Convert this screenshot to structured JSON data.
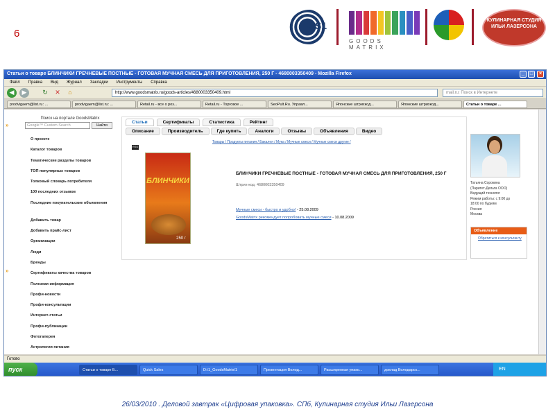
{
  "slide": {
    "number": "6",
    "footer": "26/03/2010 . Деловой завтрак «Цифровая упаковка». СПб, Кулинарная студия Ильи Лазерсона"
  },
  "logos": {
    "gs1": "GS1",
    "goods_matrix": "GOODS MATRIX",
    "studio": "КУЛИНАРНАЯ СТУДИЯ ИЛЬИ ЛАЗЕРСОНА",
    "gm_colors": [
      "#6a2b8a",
      "#b22c8a",
      "#d93a3a",
      "#f06a2a",
      "#f3c623",
      "#9fc43a",
      "#3aa35a",
      "#2a8fc0",
      "#4a5fc8",
      "#7a3ab8"
    ]
  },
  "browser": {
    "title": "Статьи о товаре БЛИНЧИКИ ГРЕЧНЕВЫЕ ПОСТНЫЕ - ГОТОВАЯ МУЧНАЯ СМЕСЬ ДЛЯ ПРИГОТОВЛЕНИЯ, 250 Г - 4680003350409 - Mozilla Firefox",
    "menu": [
      "Правка",
      "Вид",
      "Журнал",
      "Закладки",
      "Инструменты",
      "Справка"
    ],
    "menu_first": "Файл",
    "url": "http://www.goodsmatrix.ru/goods-articles/4680003350409.html",
    "search_placeholder": "mail.ru: Поиск в Интернете",
    "tabs": [
      "prodvigaem@list.ru: ...",
      "prodvigaem@list.ru: ...",
      "Retail.ru - все о роз...",
      "Retail.ru - Торговое ...",
      "SeoPult.Ru. Управл...",
      "Японские штрихкод...",
      "Японские штрихкод...",
      "Статьи о товаре ..."
    ],
    "status": "Готово"
  },
  "sidebar": {
    "search_title": "Поиск на портале GoodsMatrix",
    "search_placeholder": "Google™ Custom Search",
    "search_button": "Найти",
    "items": [
      "О проекте",
      "Каталог товаров",
      "Тематические разделы товаров",
      "ТОП популярных товаров",
      "Толковый словарь потребителя",
      "100 последних отзывов",
      "Последние покупательские объявления",
      "Добавить товар",
      "Добавить прайс-лист",
      "Организации",
      "Люди",
      "Бренды",
      "Сертификаты качества товаров",
      "Полезная информация",
      "Профи-новости",
      "Профи-консультации",
      "Интернет-статьи",
      "Профи-публикации",
      "Фотогалерея",
      "Астрология питания"
    ]
  },
  "main": {
    "tabs1": [
      "Статьи",
      "Сертификаты",
      "Статистика",
      "Рейтинг"
    ],
    "tabs2": [
      "Описание",
      "Производитель",
      "Где купить",
      "Аналоги",
      "Отзывы",
      "Объявления",
      "Видео"
    ],
    "breadcrumb": "Товары / Продукты питания / Бакалея / Мука / Мучные смеси / Мучные смеси другие /",
    "product_title": "БЛИНЧИКИ ГРЕЧНЕВЫЕ ПОСТНЫЕ - ГОТОВАЯ МУЧНАЯ СМЕСЬ ДЛЯ ПРИГОТОВЛЕНИЯ, 250 Г",
    "barcode": "Штрих-код: 4680003350409",
    "package_text": "БЛИНЧИКИ",
    "package_weight": "250 г",
    "articles": [
      {
        "link": "Мучные смеси - быстро и удобно!",
        "date": "- 25.08.2009"
      },
      {
        "link": "GoodsMatrix рекомендует попробовать мучные смеси",
        "date": "- 10.08.2009"
      }
    ]
  },
  "consultant": {
    "lines": [
      "Татьяна Сорокина",
      "(Паритет-Дельта ООО)",
      "Ведущий технолог",
      "Режим работы: с 9:00 до",
      "18:00 по будням",
      "Россия",
      "Москва"
    ],
    "ad_title": "Объявление",
    "ad_link": "Обратиться к консультанту"
  },
  "taskbar": {
    "start": "пуск",
    "buttons": [
      "Статьи о товаре Б...",
      "Quick Sales",
      "D:\\1_GoodsMatrix\\1",
      "Презентация Волод...",
      "Расширенная упако...",
      "доклад Володарск..."
    ],
    "tray_lang": "EN"
  }
}
